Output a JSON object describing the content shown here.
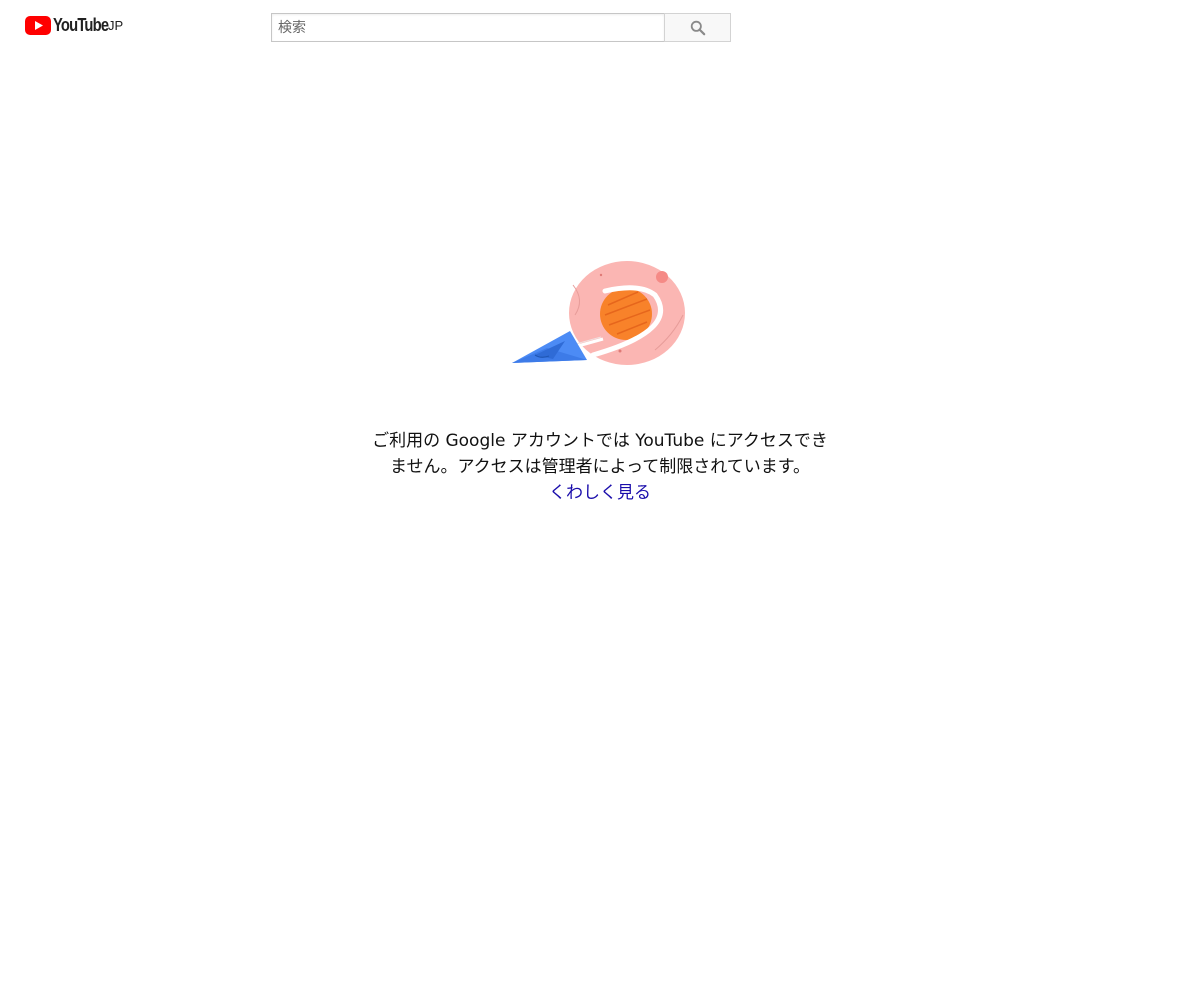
{
  "header": {
    "logo_wordmark": "YouTube",
    "logo_region": "JP",
    "brand_color": "#ff0000"
  },
  "search": {
    "placeholder": "検索",
    "button_icon": "search-icon"
  },
  "illustration": {
    "icon": "paper-plane-planet-illustration"
  },
  "message": {
    "line1": "ご利用の Google アカウントでは YouTube にアクセスでき",
    "line2": "ません。アクセスは管理者によって制限されています。",
    "link_label": "くわしく見る",
    "link_color": "#1a0dab"
  }
}
